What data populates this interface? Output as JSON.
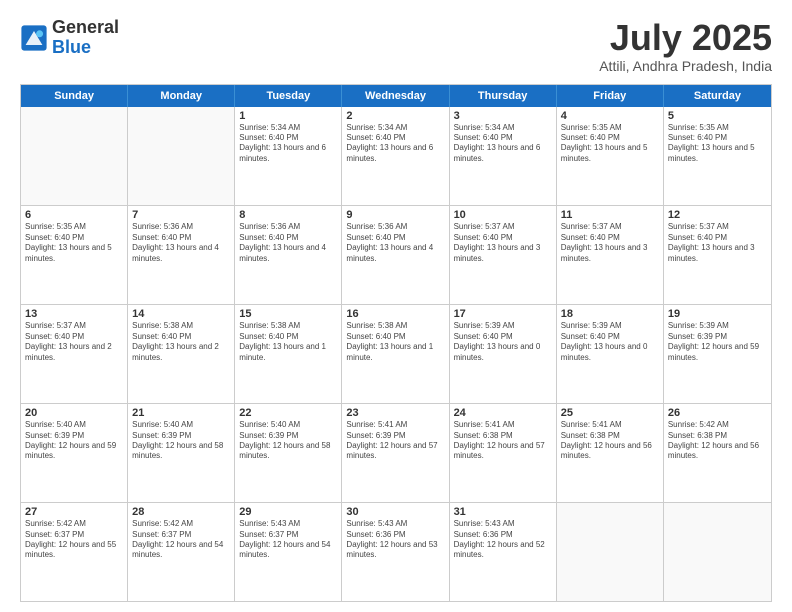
{
  "logo": {
    "general": "General",
    "blue": "Blue"
  },
  "title": "July 2025",
  "location": "Attili, Andhra Pradesh, India",
  "weekdays": [
    "Sunday",
    "Monday",
    "Tuesday",
    "Wednesday",
    "Thursday",
    "Friday",
    "Saturday"
  ],
  "weeks": [
    [
      {
        "day": "",
        "info": ""
      },
      {
        "day": "",
        "info": ""
      },
      {
        "day": "1",
        "info": "Sunrise: 5:34 AM\nSunset: 6:40 PM\nDaylight: 13 hours and 6 minutes."
      },
      {
        "day": "2",
        "info": "Sunrise: 5:34 AM\nSunset: 6:40 PM\nDaylight: 13 hours and 6 minutes."
      },
      {
        "day": "3",
        "info": "Sunrise: 5:34 AM\nSunset: 6:40 PM\nDaylight: 13 hours and 6 minutes."
      },
      {
        "day": "4",
        "info": "Sunrise: 5:35 AM\nSunset: 6:40 PM\nDaylight: 13 hours and 5 minutes."
      },
      {
        "day": "5",
        "info": "Sunrise: 5:35 AM\nSunset: 6:40 PM\nDaylight: 13 hours and 5 minutes."
      }
    ],
    [
      {
        "day": "6",
        "info": "Sunrise: 5:35 AM\nSunset: 6:40 PM\nDaylight: 13 hours and 5 minutes."
      },
      {
        "day": "7",
        "info": "Sunrise: 5:36 AM\nSunset: 6:40 PM\nDaylight: 13 hours and 4 minutes."
      },
      {
        "day": "8",
        "info": "Sunrise: 5:36 AM\nSunset: 6:40 PM\nDaylight: 13 hours and 4 minutes."
      },
      {
        "day": "9",
        "info": "Sunrise: 5:36 AM\nSunset: 6:40 PM\nDaylight: 13 hours and 4 minutes."
      },
      {
        "day": "10",
        "info": "Sunrise: 5:37 AM\nSunset: 6:40 PM\nDaylight: 13 hours and 3 minutes."
      },
      {
        "day": "11",
        "info": "Sunrise: 5:37 AM\nSunset: 6:40 PM\nDaylight: 13 hours and 3 minutes."
      },
      {
        "day": "12",
        "info": "Sunrise: 5:37 AM\nSunset: 6:40 PM\nDaylight: 13 hours and 3 minutes."
      }
    ],
    [
      {
        "day": "13",
        "info": "Sunrise: 5:37 AM\nSunset: 6:40 PM\nDaylight: 13 hours and 2 minutes."
      },
      {
        "day": "14",
        "info": "Sunrise: 5:38 AM\nSunset: 6:40 PM\nDaylight: 13 hours and 2 minutes."
      },
      {
        "day": "15",
        "info": "Sunrise: 5:38 AM\nSunset: 6:40 PM\nDaylight: 13 hours and 1 minute."
      },
      {
        "day": "16",
        "info": "Sunrise: 5:38 AM\nSunset: 6:40 PM\nDaylight: 13 hours and 1 minute."
      },
      {
        "day": "17",
        "info": "Sunrise: 5:39 AM\nSunset: 6:40 PM\nDaylight: 13 hours and 0 minutes."
      },
      {
        "day": "18",
        "info": "Sunrise: 5:39 AM\nSunset: 6:40 PM\nDaylight: 13 hours and 0 minutes."
      },
      {
        "day": "19",
        "info": "Sunrise: 5:39 AM\nSunset: 6:39 PM\nDaylight: 12 hours and 59 minutes."
      }
    ],
    [
      {
        "day": "20",
        "info": "Sunrise: 5:40 AM\nSunset: 6:39 PM\nDaylight: 12 hours and 59 minutes."
      },
      {
        "day": "21",
        "info": "Sunrise: 5:40 AM\nSunset: 6:39 PM\nDaylight: 12 hours and 58 minutes."
      },
      {
        "day": "22",
        "info": "Sunrise: 5:40 AM\nSunset: 6:39 PM\nDaylight: 12 hours and 58 minutes."
      },
      {
        "day": "23",
        "info": "Sunrise: 5:41 AM\nSunset: 6:39 PM\nDaylight: 12 hours and 57 minutes."
      },
      {
        "day": "24",
        "info": "Sunrise: 5:41 AM\nSunset: 6:38 PM\nDaylight: 12 hours and 57 minutes."
      },
      {
        "day": "25",
        "info": "Sunrise: 5:41 AM\nSunset: 6:38 PM\nDaylight: 12 hours and 56 minutes."
      },
      {
        "day": "26",
        "info": "Sunrise: 5:42 AM\nSunset: 6:38 PM\nDaylight: 12 hours and 56 minutes."
      }
    ],
    [
      {
        "day": "27",
        "info": "Sunrise: 5:42 AM\nSunset: 6:37 PM\nDaylight: 12 hours and 55 minutes."
      },
      {
        "day": "28",
        "info": "Sunrise: 5:42 AM\nSunset: 6:37 PM\nDaylight: 12 hours and 54 minutes."
      },
      {
        "day": "29",
        "info": "Sunrise: 5:43 AM\nSunset: 6:37 PM\nDaylight: 12 hours and 54 minutes."
      },
      {
        "day": "30",
        "info": "Sunrise: 5:43 AM\nSunset: 6:36 PM\nDaylight: 12 hours and 53 minutes."
      },
      {
        "day": "31",
        "info": "Sunrise: 5:43 AM\nSunset: 6:36 PM\nDaylight: 12 hours and 52 minutes."
      },
      {
        "day": "",
        "info": ""
      },
      {
        "day": "",
        "info": ""
      }
    ]
  ]
}
